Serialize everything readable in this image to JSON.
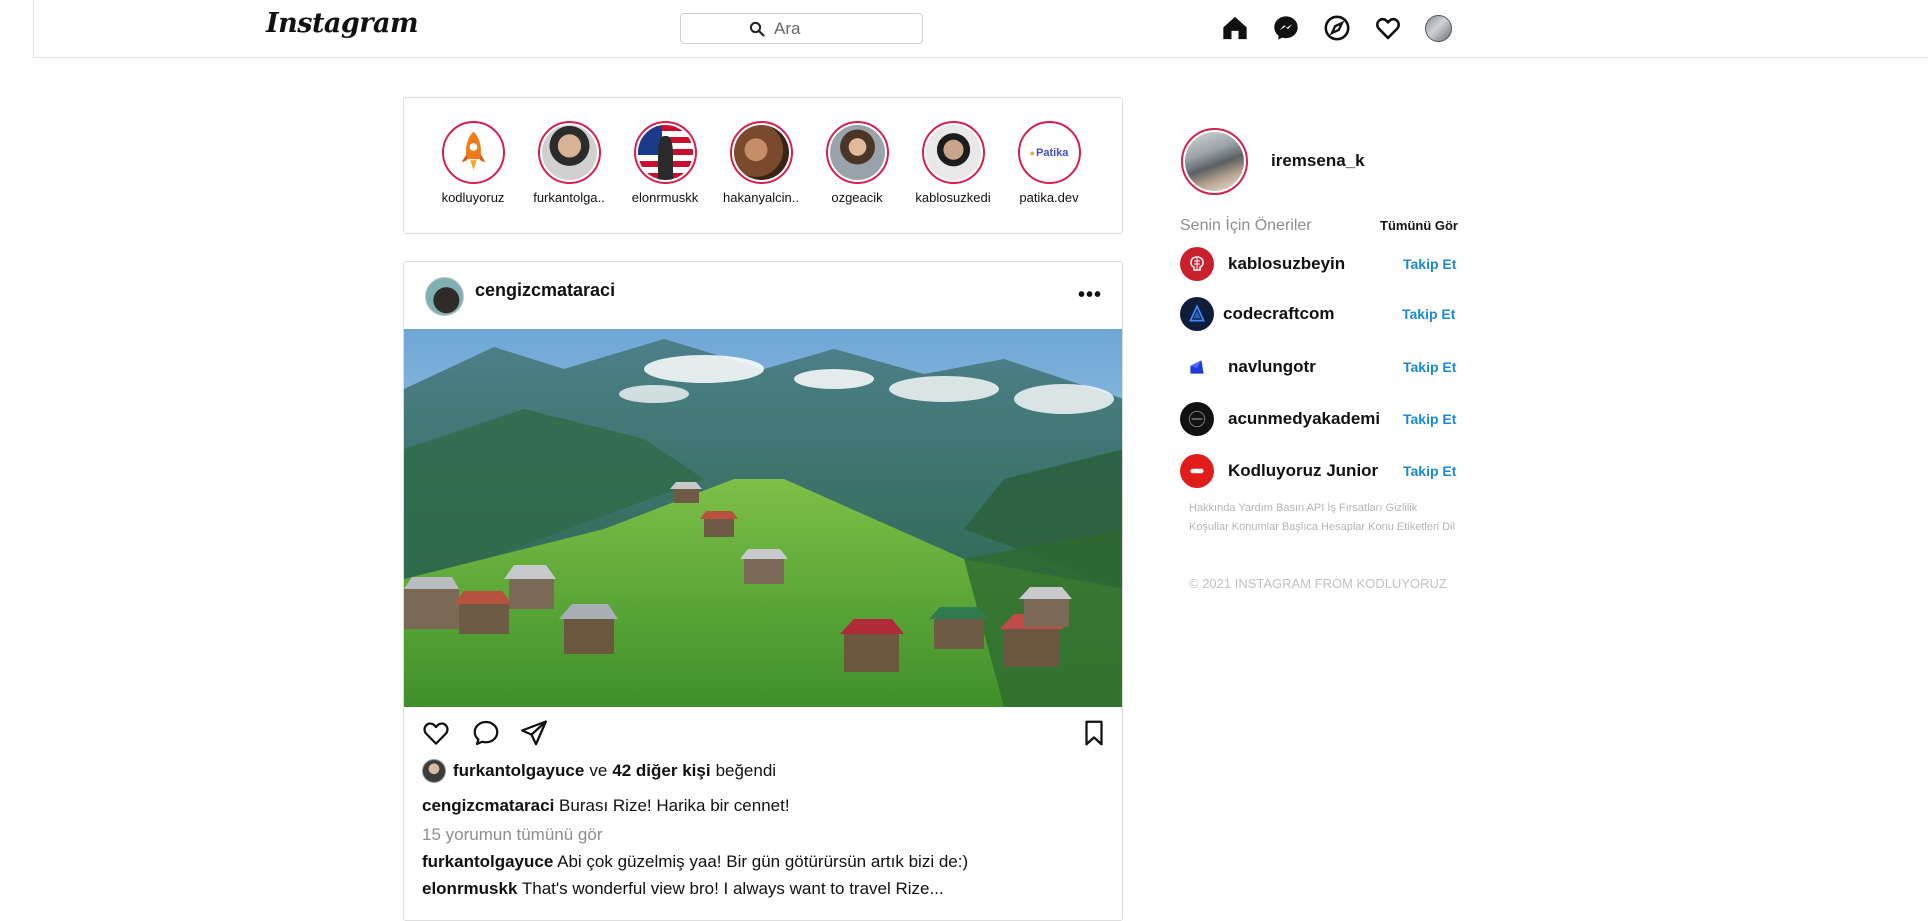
{
  "header": {
    "logo": "Instagram",
    "search_placeholder": "Ara"
  },
  "stories": [
    {
      "name": "kodluyoruz"
    },
    {
      "name": "furkantolga.."
    },
    {
      "name": "elonrmuskk"
    },
    {
      "name": "hakanyalcin.."
    },
    {
      "name": "ozgeacik"
    },
    {
      "name": "kablosuzkedi"
    },
    {
      "name": "patika.dev"
    }
  ],
  "patika_logo_text": "Patika",
  "post": {
    "username": "cengizcmataraci",
    "more_label": "•••",
    "likes": {
      "user": "furkantolgayuce",
      "and": "ve",
      "others": "42 diğer kişi",
      "liked": "beğendi"
    },
    "caption": {
      "user": "cengizcmataraci",
      "text": "Burası Rize! Harika bir cennet!"
    },
    "view_all_comments": "15 yorumun tümünü gör",
    "comments": [
      {
        "user": "furkantolgayuce",
        "text": "Abi çok güzelmiş yaa! Bir gün götürürsün artık bizi de:)"
      },
      {
        "user": "elonrmuskk",
        "text": "That's wonderful view bro! I always want to travel Rize..."
      }
    ]
  },
  "sidebar": {
    "username": "iremsena_k",
    "suggestions_title": "Senin İçin Öneriler",
    "see_all": "Tümünü Gör",
    "follow_label": "Takip Et",
    "suggestions": [
      {
        "name": "kablosuzbeyin"
      },
      {
        "name": "codecraftcom"
      },
      {
        "name": "navlungotr"
      },
      {
        "name": "acunmedyakademi"
      },
      {
        "name": "Kodluyoruz Junior"
      }
    ],
    "footer_links": "Hakkında Yardım Basın API İş Fırsatları Gizlilik Koşullar Konumlar Başlıca Hesaplar Konu Etiketleri Dil",
    "copyright": "© 2021 INSTAGRAM FROM KODLUYORUZ"
  },
  "colors": {
    "story_ring": "#d6204f",
    "follow_blue": "#1a8ad8",
    "muted_text": "#8e8e8e",
    "border": "#dcdcdc"
  }
}
